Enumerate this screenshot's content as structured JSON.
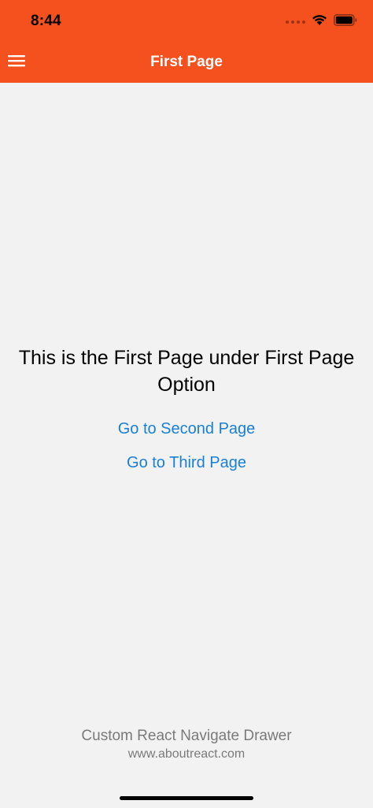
{
  "status_bar": {
    "time": "8:44"
  },
  "header": {
    "title": "First Page",
    "background_color": "#f4511e",
    "menu_icon": "hamburger-menu-icon"
  },
  "main": {
    "message": "This is the First Page under First Page Option",
    "links": [
      {
        "label": "Go to Second Page"
      },
      {
        "label": "Go to Third Page"
      }
    ],
    "link_color": "#1a7fd6"
  },
  "footer": {
    "title": "Custom React Navigate Drawer",
    "url": "www.aboutreact.com"
  }
}
